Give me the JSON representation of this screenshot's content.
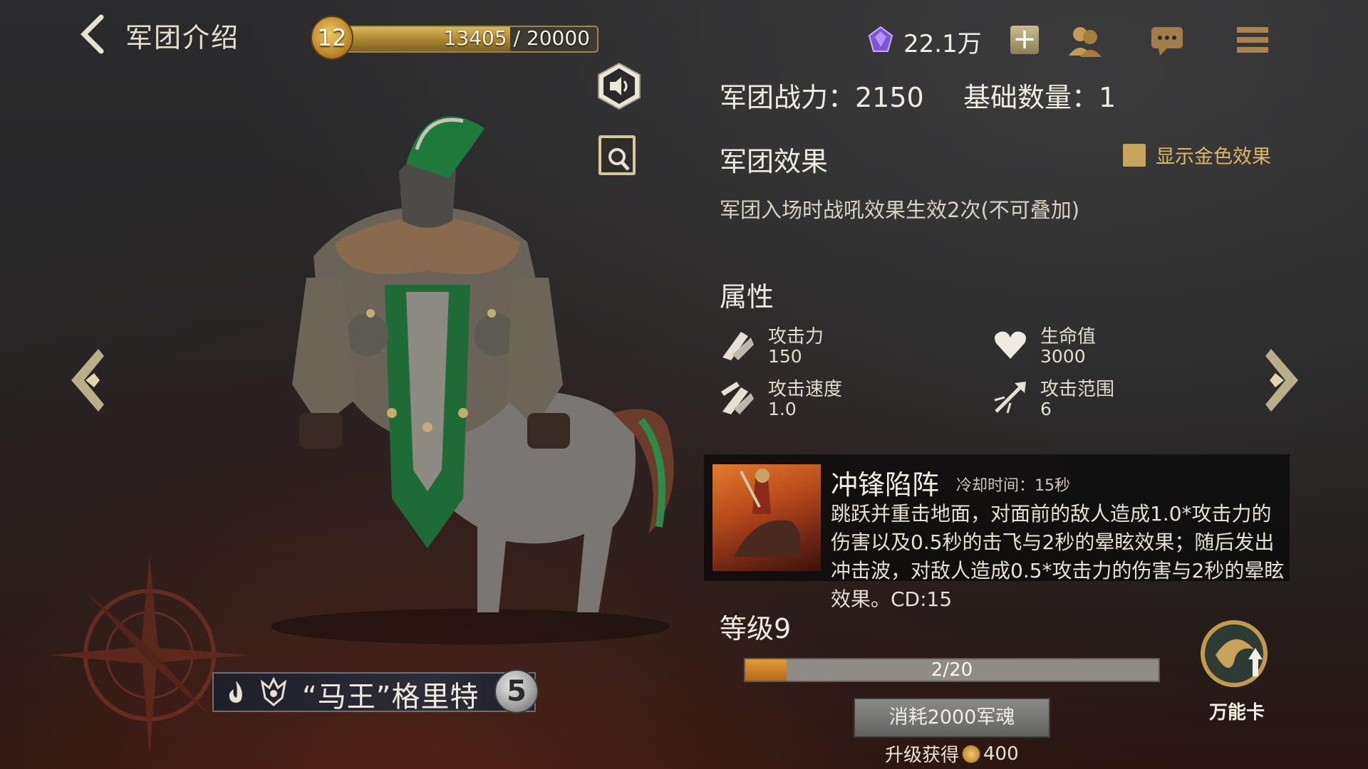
{
  "header": {
    "title": "军团介绍",
    "level": "12",
    "xp_text": "13405 / 20000",
    "xp_current": 13405,
    "xp_max": 20000,
    "currency": "22.1万",
    "plus": "+"
  },
  "icons": {
    "back": "back-arrow-icon",
    "gem": "purple-gem-icon",
    "friends": "friends-icon",
    "chat": "chat-icon",
    "menu": "menu-icon",
    "speaker": "speaker-icon",
    "zoom": "magnify-icon"
  },
  "info": {
    "power": "军团战力：2150",
    "base_count": "基础数量：1",
    "effect_title": "军团效果",
    "gold_toggle": "显示金色效果",
    "effect_desc": "军团入场时战吼效果生效2次(不可叠加)",
    "attr_title": "属性",
    "stats": [
      {
        "name": "攻击力",
        "value": "150",
        "icon": "attack-icon"
      },
      {
        "name": "生命值",
        "value": "3000",
        "icon": "heart-icon"
      },
      {
        "name": "攻击速度",
        "value": "1.0",
        "icon": "attack-speed-icon"
      },
      {
        "name": "攻击范围",
        "value": "6",
        "icon": "attack-range-icon"
      }
    ]
  },
  "skill": {
    "name": "冲锋陷阵",
    "cooldown": "冷却时间：15秒",
    "desc": "跳跃并重击地面，对面前的敌人造成1.0*攻击力的伤害以及0.5秒的击飞与2秒的晕眩效果；随后发出冲击波，对敌人造成0.5*攻击力的伤害与2秒的晕眩效果。CD:15"
  },
  "level": {
    "label": "等级9",
    "progress_text": "2/20",
    "progress_current": 2,
    "progress_max": 20,
    "consume_button": "消耗2000军魂",
    "upgrade_prefix": "升级获得",
    "upgrade_amount": "400",
    "wildcard_label": "万能卡"
  },
  "unit": {
    "name": "“马王”格里特",
    "stars": "5"
  }
}
